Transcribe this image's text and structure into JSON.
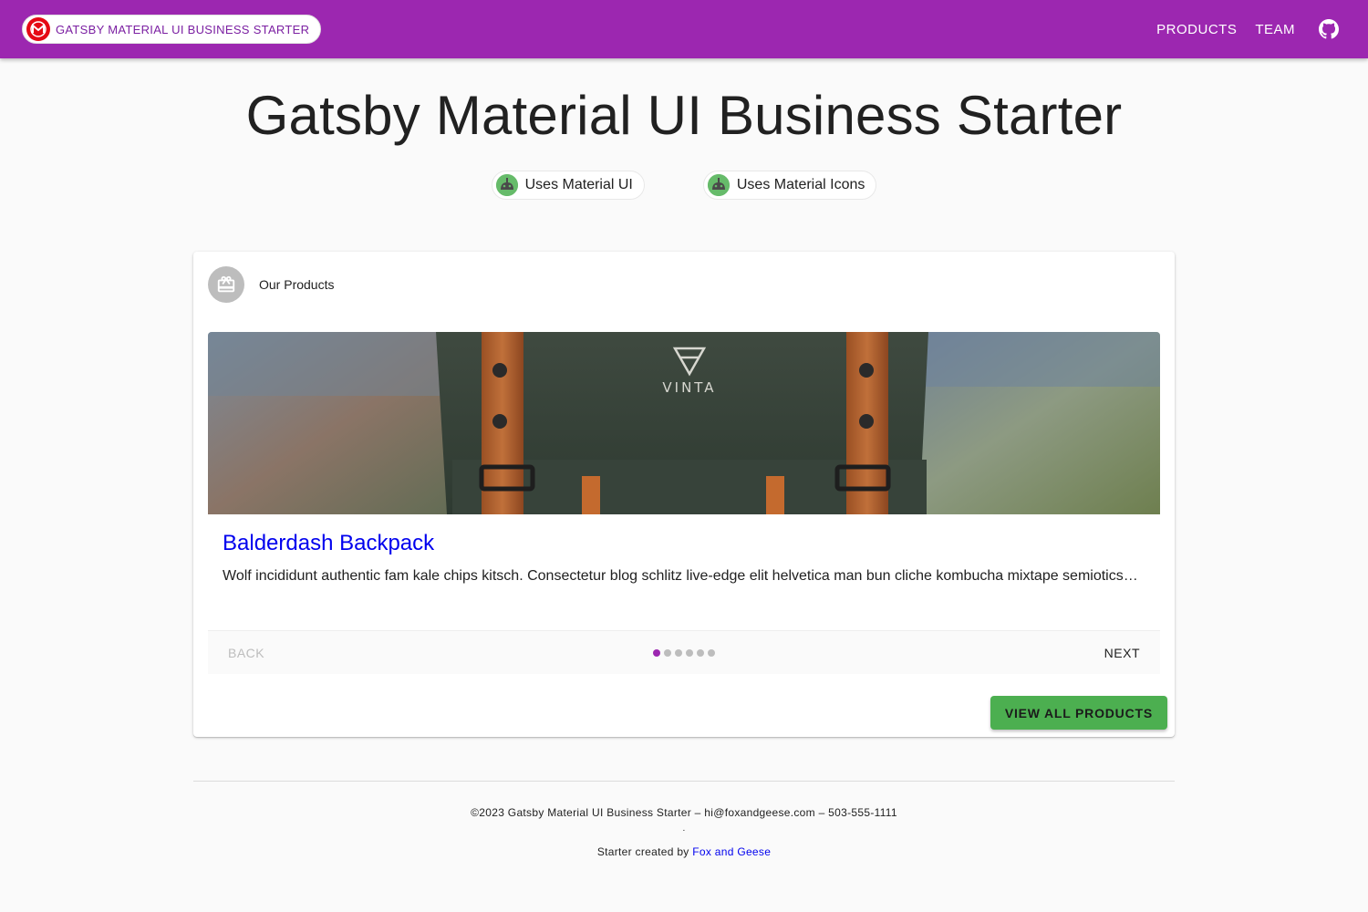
{
  "header": {
    "brand_label": "GATSBY MATERIAL UI BUSINESS STARTER",
    "nav": [
      "PRODUCTS",
      "TEAM"
    ],
    "github_icon": "github-icon",
    "bar_color": "#9c27b0"
  },
  "hero": {
    "title": "Gatsby Material UI Business Starter",
    "chips": [
      "Uses Material UI",
      "Uses Material Icons"
    ]
  },
  "products_card": {
    "title": "Our Products",
    "icon": "gift-icon",
    "product": {
      "name": "Balderdash Backpack",
      "description": "Wolf incididunt authentic fam kale chips kitsch. Consectetur blog schlitz live-edge elit helvetica man bun cliche kombucha mixtape semiotics…",
      "image_text": "VINTA"
    },
    "stepper": {
      "back_label": "BACK",
      "next_label": "NEXT",
      "steps_total": 6,
      "active_step": 1
    },
    "view_all_label": "VIEW ALL PRODUCTS"
  },
  "footer": {
    "line1": "©2023 Gatsby Material UI Business Starter – hi@foxandgeese.com – 503-555-1111",
    "separator": ".",
    "credit_prefix": "Starter created by ",
    "credit_link": "Fox and Geese"
  }
}
